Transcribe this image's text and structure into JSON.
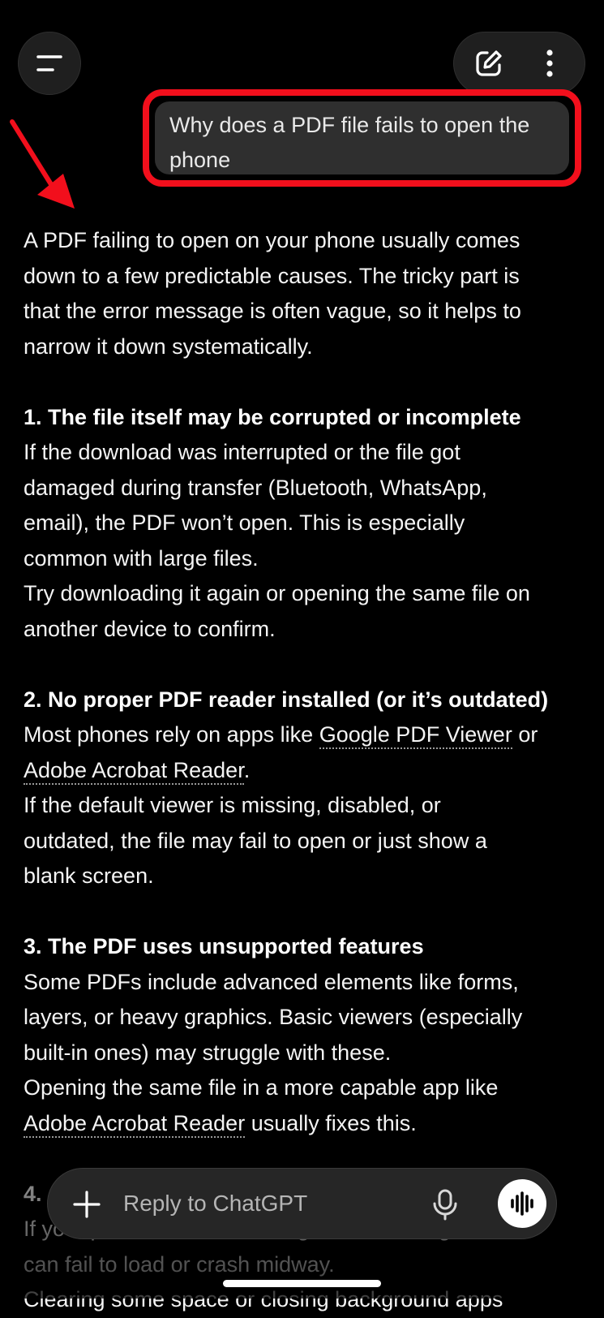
{
  "header": {
    "menu_icon": "menu-icon",
    "new_chat_icon": "edit-icon",
    "more_icon": "more-vertical-icon"
  },
  "user_message": {
    "line1": "Why does a PDF file fails to open the",
    "line2": "phone"
  },
  "annotation": {
    "highlight_color": "#f20f1c"
  },
  "response": {
    "intro": [
      "A PDF failing to open on your phone usually comes",
      "down to a few predictable causes. The tricky part is",
      "that the error message is often vague, so it helps to",
      "narrow it down systematically."
    ],
    "section1": {
      "heading": "1. The file itself may be corrupted or incomplete",
      "lines": [
        "If the download was interrupted or the file got",
        "damaged during transfer (Bluetooth, WhatsApp,",
        "email), the PDF won’t open. This is especially",
        "common with large files.",
        "Try downloading it again or opening the same file on",
        "another device to confirm."
      ]
    },
    "section2": {
      "heading": "2. No proper PDF reader installed (or it’s outdated)",
      "line1_prefix": "Most phones rely on apps like ",
      "link1": "Google PDF Viewer",
      "line1_suffix": " or",
      "link2": "Adobe Acrobat Reader",
      "line2_suffix": ".",
      "lines": [
        "If the default viewer is missing, disabled, or",
        "outdated, the file may fail to open or just show a",
        "blank screen."
      ]
    },
    "section3": {
      "heading": "3. The PDF uses unsupported features",
      "lines": [
        "Some PDFs include advanced elements like forms,",
        "layers, or heavy graphics. Basic viewers (especially",
        "built-in ones) may struggle with these.",
        "Opening the same file in a more capable app like"
      ],
      "link": "Adobe Acrobat Reader",
      "last_suffix": " usually fixes this."
    },
    "section4": {
      "heading_partial": "4.",
      "lines": [
        "If your phone is low on storage or RAM, larger PDFs",
        "can fail to load or crash midway.",
        "Clearing some space or closing background apps"
      ]
    }
  },
  "composer": {
    "placeholder": "Reply to ChatGPT",
    "plus_icon": "plus-icon",
    "mic_icon": "microphone-icon",
    "voice_icon": "voice-mode-icon"
  }
}
